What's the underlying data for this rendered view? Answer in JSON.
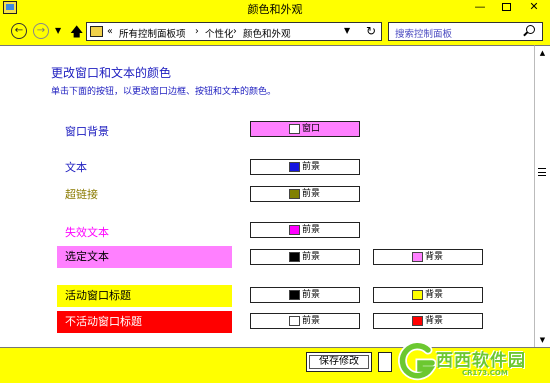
{
  "window": {
    "title": "颜色和外观",
    "min_glyph": "—",
    "close_glyph": "✕"
  },
  "nav": {
    "back_glyph": "←",
    "forward_glyph": "→",
    "dropdown_glyph": "▼",
    "up_glyph": "🡅",
    "address_prefix": "«",
    "breadcrumbs": [
      "所有控制面板项",
      "个性化",
      "颜色和外观"
    ],
    "separator": "›",
    "refresh_glyph": "↻",
    "search_placeholder": "搜索控制面板"
  },
  "main": {
    "heading": "更改窗口和文本的颜色",
    "subheading": "单击下面的按钮，以更改窗口边框、按钮和文本的颜色。",
    "items": [
      {
        "label": "窗口背景",
        "label_color": "#1d1dbf",
        "label_bg": "",
        "buttons": [
          {
            "text": "窗口",
            "color": "#ffffff"
          }
        ],
        "row_bg": "#ff80ff"
      },
      {
        "label": "文本",
        "label_color": "#1d1dbf",
        "label_bg": "",
        "buttons": [
          {
            "text": "前景",
            "color": "#1515e0"
          }
        ]
      },
      {
        "label": "超链接",
        "label_color": "#8a7a00",
        "label_bg": "",
        "buttons": [
          {
            "text": "前景",
            "color": "#808000"
          }
        ]
      },
      {
        "label": "失效文本",
        "label_color": "#ff00ff",
        "label_bg": "",
        "buttons": [
          {
            "text": "前景",
            "color": "#ff00ff"
          }
        ]
      },
      {
        "label": "选定文本",
        "label_color": "#000000",
        "label_bg": "#ff80ff",
        "buttons": [
          {
            "text": "前景",
            "color": "#000000"
          },
          {
            "text": "背景",
            "color": "#ff80ff"
          }
        ]
      },
      {
        "label": "活动窗口标题",
        "label_color": "#000000",
        "label_bg": "#ffff00",
        "buttons": [
          {
            "text": "前景",
            "color": "#000000"
          },
          {
            "text": "背景",
            "color": "#ffff00"
          }
        ]
      },
      {
        "label": "不活动窗口标题",
        "label_color": "#ffffff",
        "label_bg": "#ff0000",
        "buttons": [
          {
            "text": "前景",
            "color": "#ffffff"
          },
          {
            "text": "背景",
            "color": "#ff0000"
          }
        ]
      }
    ]
  },
  "footer": {
    "save_label": "保存修改"
  },
  "watermark": {
    "brand": "西西软件园",
    "url": "CR173.COM"
  },
  "colors": {
    "chrome": "#ffff00",
    "text_blue": "#1d1dbf",
    "watermark_green": "#6cc830"
  },
  "icons": {
    "app": "control-panel-icon",
    "search": "search-icon"
  }
}
